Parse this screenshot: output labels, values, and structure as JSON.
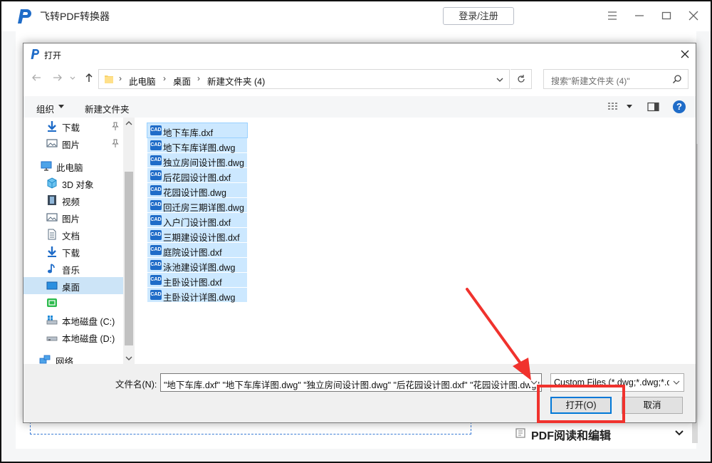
{
  "app": {
    "title": "飞转PDF转换器",
    "login_label": "登录/注册",
    "icons": {
      "logo": "p-logo-icon",
      "menu": "hamburger-icon",
      "minimize": "minimize-icon",
      "maximize": "maximize-icon",
      "close": "close-icon"
    },
    "pdf_edit": {
      "label": "PDF阅读和编辑",
      "icon": "document-icon"
    }
  },
  "dialog": {
    "title": "打开",
    "breadcrumbs": [
      "此电脑",
      "桌面",
      "新建文件夹 (4)"
    ],
    "search_placeholder": "搜索\"新建文件夹 (4)\"",
    "toolbar": {
      "organize": "组织",
      "new_folder": "新建文件夹",
      "help": "?"
    },
    "nav_items": [
      {
        "label": "下载",
        "icon": "download-arrow-icon",
        "pinned": true
      },
      {
        "label": "图片",
        "icon": "pictures-icon",
        "pinned": true
      },
      {
        "label": "此电脑",
        "icon": "computer-icon"
      },
      {
        "label": "3D 对象",
        "icon": "3d-objects-icon"
      },
      {
        "label": "视频",
        "icon": "video-icon"
      },
      {
        "label": "图片",
        "icon": "pictures-icon"
      },
      {
        "label": "文档",
        "icon": "document-icon"
      },
      {
        "label": "下载",
        "icon": "download-arrow-icon"
      },
      {
        "label": "音乐",
        "icon": "music-note-icon"
      },
      {
        "label": "桌面",
        "icon": "desktop-icon",
        "selected": true
      },
      {
        "label": "",
        "icon": "green-drive-icon"
      },
      {
        "label": "本地磁盘 (C:)",
        "icon": "windows-drive-icon"
      },
      {
        "label": "本地磁盘 (D:)",
        "icon": "drive-icon"
      },
      {
        "label": "网络",
        "icon": "network-icon"
      }
    ],
    "files": [
      "地下车库.dxf",
      "地下车库详图.dwg",
      "独立房间设计图.dwg",
      "后花园设计图.dxf",
      "花园设计图.dwg",
      "回迁房三期详图.dwg",
      "入户门设计图.dxf",
      "三期建设设计图.dxf",
      "庭院设计图.dxf",
      "泳池建设详图.dwg",
      "主卧设计图.dxf",
      "主卧设计详图.dwg"
    ],
    "file_icon_text": "CAD",
    "filename_label": "文件名(N):",
    "filename_value": "\"地下车库.dxf\" \"地下车库详图.dwg\" \"独立房间设计图.dwg\" \"后花园设计图.dxf\" \"花园设计图.dwg\"",
    "filter_value": "Custom Files (*.dwg;*.dwg;*.dxf)",
    "open_label": "打开(O)",
    "cancel_label": "取消"
  },
  "colors": {
    "accent": "#0078d7",
    "selection": "#cce8ff",
    "annotation": "#f0322d"
  }
}
